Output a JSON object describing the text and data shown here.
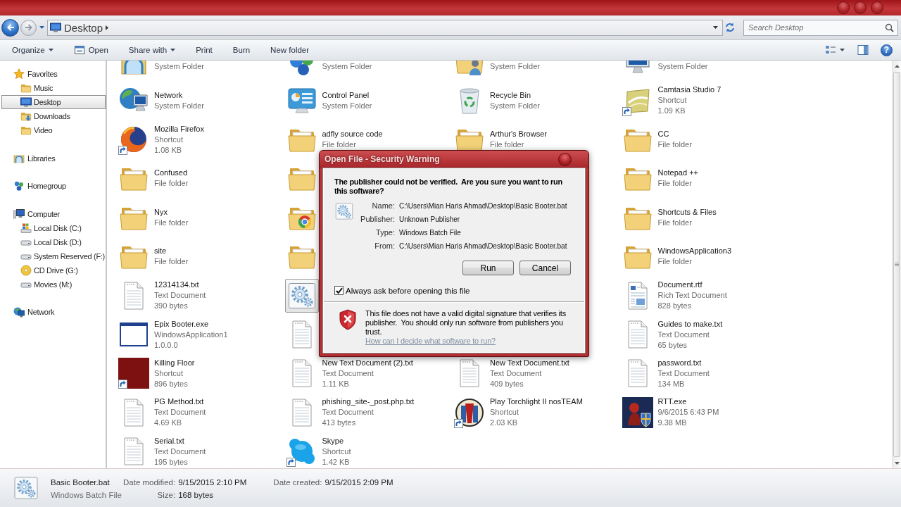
{
  "address_bar": {
    "back": {
      "disabled": false
    },
    "forward": {
      "disabled": true
    },
    "location": "Desktop",
    "search": {
      "placeholder": "Search Desktop"
    }
  },
  "toolbar": {
    "buttons": [
      {
        "label": "Organize",
        "kind": "menu"
      },
      {
        "label": "Open",
        "kind": "open"
      },
      {
        "label": "Share with",
        "kind": "menu"
      },
      {
        "label": "Print",
        "kind": "plain"
      },
      {
        "label": "Burn",
        "kind": "plain"
      },
      {
        "label": "New folder",
        "kind": "plain"
      }
    ],
    "help": "?"
  },
  "navigation": [
    {
      "label": "Favorites",
      "kind": "favorites",
      "selected": false,
      "children": [
        {
          "label": "Music",
          "kind": "folder",
          "selected": false
        },
        {
          "label": "Desktop",
          "kind": "desktop",
          "selected": true
        },
        {
          "label": "Downloads",
          "kind": "downloads",
          "selected": false
        },
        {
          "label": "Video",
          "kind": "folder",
          "selected": false
        }
      ]
    },
    {
      "label": "Libraries",
      "kind": "libraries",
      "selected": false
    },
    {
      "label": "Homegroup",
      "kind": "homegroup",
      "selected": false
    },
    {
      "label": "Computer",
      "kind": "computer",
      "selected": false,
      "children": [
        {
          "label": "Local Disk (C:)",
          "kind": "windisk",
          "selected": false
        },
        {
          "label": "Local Disk (D:)",
          "kind": "disk",
          "selected": false
        },
        {
          "label": "System Reserved (F:)",
          "kind": "disk",
          "selected": false
        },
        {
          "label": "CD Drive (G:)",
          "kind": "cd",
          "selected": false
        },
        {
          "label": "Movies (M:)",
          "kind": "disk",
          "selected": false
        }
      ]
    },
    {
      "label": "Network",
      "kind": "network",
      "selected": false
    }
  ],
  "files": {
    "cut_off_row": [
      {
        "kind": "library",
        "info": [
          "System Folder"
        ]
      },
      {
        "kind": "homegroup",
        "info": [
          "System Folder"
        ]
      },
      {
        "kind": "userfolder",
        "info": [
          "System Folder"
        ]
      },
      {
        "kind": "computer",
        "info": [
          "System Folder"
        ]
      }
    ],
    "rows": [
      [
        {
          "kind": "network",
          "name": "Network",
          "info": [
            "System Folder"
          ],
          "shortcut": false,
          "selected": false
        },
        {
          "kind": "controlpanel",
          "name": "Control Panel",
          "info": [
            "System Folder"
          ],
          "shortcut": false,
          "selected": false
        },
        {
          "kind": "recyclebin",
          "name": "Recycle Bin",
          "info": [
            "System Folder"
          ],
          "shortcut": false,
          "selected": false
        },
        {
          "kind": "camtasia",
          "name": "Camtasia Studio 7",
          "info": [
            "Shortcut",
            "1.09 KB"
          ],
          "shortcut": true,
          "selected": false
        }
      ],
      [
        {
          "kind": "firefox",
          "name": "Mozilla Firefox",
          "info": [
            "Shortcut",
            "1.08 KB"
          ],
          "shortcut": true,
          "selected": false
        },
        {
          "kind": "folder",
          "name": "adfly source code",
          "info": [
            "File folder"
          ],
          "shortcut": false,
          "selected": false
        },
        {
          "kind": "folder",
          "name": "Arthur's Browser",
          "info": [
            "File folder"
          ],
          "shortcut": false,
          "selected": false
        },
        {
          "kind": "folder",
          "name": "CC",
          "info": [
            "File folder"
          ],
          "shortcut": false,
          "selected": false
        }
      ],
      [
        {
          "kind": "folder",
          "name": "Confused",
          "info": [
            "File folder"
          ],
          "shortcut": false,
          "selected": false
        },
        {
          "kind": "folder",
          "shortcut": false,
          "selected": false
        },
        null,
        {
          "kind": "folder",
          "name": "Notepad ++",
          "info": [
            "File folder"
          ],
          "shortcut": false,
          "selected": false
        }
      ],
      [
        {
          "kind": "folder",
          "name": "Nyx",
          "info": [
            "File folder"
          ],
          "shortcut": false,
          "selected": false
        },
        {
          "kind": "chromefolder",
          "shortcut": false,
          "selected": false
        },
        null,
        {
          "kind": "folder",
          "name": "Shortcuts & Files",
          "info": [
            "File folder"
          ],
          "shortcut": false,
          "selected": false
        }
      ],
      [
        {
          "kind": "folder",
          "name": "site",
          "info": [
            "File folder"
          ],
          "shortcut": false,
          "selected": false
        },
        {
          "kind": "folder",
          "shortcut": false,
          "selected": false
        },
        null,
        {
          "kind": "folder",
          "name": "WindowsApplication3",
          "info": [
            "File folder"
          ],
          "shortcut": false,
          "selected": false
        }
      ],
      [
        {
          "kind": "textfile",
          "name": "12314134.txt",
          "info": [
            "Text Document",
            "390 bytes"
          ],
          "shortcut": false,
          "selected": false
        },
        {
          "kind": "batch",
          "shortcut": false,
          "selected": true
        },
        null,
        {
          "kind": "richtext",
          "name": "Document.rtf",
          "info": [
            "Rich Text Document",
            "828 bytes"
          ],
          "shortcut": false,
          "selected": false
        }
      ],
      [
        {
          "kind": "program",
          "name": "Epix Booter.exe",
          "info": [
            "WindowsApplication1",
            "1.0.0.0"
          ],
          "shortcut": false,
          "selected": false
        },
        {
          "kind": "textfile",
          "shortcut": false,
          "selected": false
        },
        null,
        {
          "kind": "textfile",
          "name": "Guides to make.txt",
          "info": [
            "Text Document",
            "65 bytes"
          ],
          "shortcut": false,
          "selected": false
        }
      ],
      [
        {
          "kind": "game",
          "name": "Killing Floor",
          "info": [
            "Shortcut",
            "896 bytes"
          ],
          "shortcut": true,
          "selected": false
        },
        {
          "kind": "textfile",
          "name": "New Text Document (2).txt",
          "info": [
            "Text Document",
            "1.11 KB"
          ],
          "shortcut": false,
          "selected": false
        },
        {
          "kind": "textfile",
          "name": "New Text Document.txt",
          "info": [
            "Text Document",
            "409 bytes"
          ],
          "shortcut": false,
          "selected": false
        },
        {
          "kind": "textfile",
          "name": "password.txt",
          "info": [
            "Text Document",
            "134 MB"
          ],
          "shortcut": false,
          "selected": false
        }
      ],
      [
        {
          "kind": "textfile",
          "name": "PG Method.txt",
          "info": [
            "Text Document",
            "4.69 KB"
          ],
          "shortcut": false,
          "selected": false
        },
        {
          "kind": "textfile",
          "name": "phishing_site-_post.php.txt",
          "info": [
            "Text Document",
            "413 bytes"
          ],
          "shortcut": false,
          "selected": false
        },
        {
          "kind": "torchlight",
          "name": "Play Torchlight II nosTEAM",
          "info": [
            "Shortcut",
            "2.03 KB"
          ],
          "shortcut": true,
          "selected": false
        },
        {
          "kind": "rtt",
          "name": "RTT.exe",
          "info": [
            "9/6/2015 6:43 PM",
            "9.38 MB"
          ],
          "shortcut": false,
          "selected": false
        }
      ],
      [
        {
          "kind": "textfile",
          "name": "Serial.txt",
          "info": [
            "Text Document",
            "195 bytes"
          ],
          "shortcut": false,
          "selected": false
        },
        {
          "kind": "skype",
          "name": "Skype",
          "info": [
            "Shortcut",
            "1.42 KB"
          ],
          "shortcut": true,
          "selected": false
        }
      ]
    ]
  },
  "dialog": {
    "title": "Open File - Security Warning",
    "heading": "The publisher could not be verified.  Are you sure you want to run this software?",
    "details": [
      {
        "label": "Name:",
        "value": "C:\\Users\\Mian Haris Ahmad\\Desktop\\Basic Booter.bat"
      },
      {
        "label": "Publisher:",
        "value": "Unknown Publisher"
      },
      {
        "label": "Type:",
        "value": "Windows Batch File"
      },
      {
        "label": "From:",
        "value": "C:\\Users\\Mian Haris Ahmad\\Desktop\\Basic Booter.bat"
      }
    ],
    "buttons": [
      "Run",
      "Cancel"
    ],
    "checkbox": {
      "label": "Always ask before opening this file",
      "checked": true
    },
    "warning": {
      "text": "This file does not have a valid digital signature that verifies its publisher.  You should only run software from publishers you trust.",
      "link": "How can I decide what software to run?"
    }
  },
  "details_pane": {
    "name": "Basic Booter.bat",
    "type": "Windows Batch File",
    "fields": [
      {
        "label": "Date modified:",
        "value": "9/15/2015 2:10 PM"
      },
      {
        "label": "Date created:",
        "value": "9/15/2015 2:09 PM"
      },
      {
        "label": "Size:",
        "value": "168 bytes"
      }
    ]
  }
}
